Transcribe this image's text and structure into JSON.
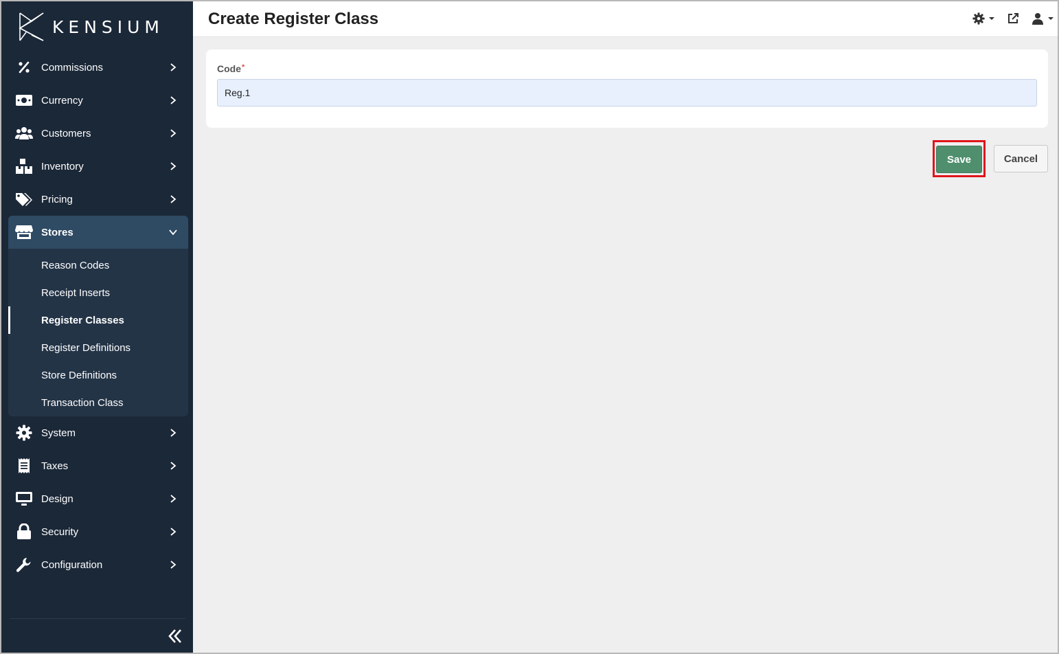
{
  "brand": {
    "name": "KENSIUM"
  },
  "header": {
    "title": "Create Register Class"
  },
  "sidebar": {
    "items": [
      {
        "label": "Commissions",
        "icon": "percent-icon"
      },
      {
        "label": "Currency",
        "icon": "money-bill-icon"
      },
      {
        "label": "Customers",
        "icon": "users-icon"
      },
      {
        "label": "Inventory",
        "icon": "boxes-icon"
      },
      {
        "label": "Pricing",
        "icon": "tags-icon"
      },
      {
        "label": "Stores",
        "icon": "store-icon",
        "expanded": true
      },
      {
        "label": "System",
        "icon": "gear-icon"
      },
      {
        "label": "Taxes",
        "icon": "receipt-icon"
      },
      {
        "label": "Design",
        "icon": "monitor-icon"
      },
      {
        "label": "Security",
        "icon": "lock-icon"
      },
      {
        "label": "Configuration",
        "icon": "wrench-icon"
      }
    ],
    "stores_sub": [
      {
        "label": "Reason Codes"
      },
      {
        "label": "Receipt Inserts"
      },
      {
        "label": "Register Classes",
        "current": true
      },
      {
        "label": "Register Definitions"
      },
      {
        "label": "Store Definitions"
      },
      {
        "label": "Transaction Class"
      }
    ]
  },
  "form": {
    "code_label": "Code",
    "required_mark": "*",
    "code_value": "Reg.1"
  },
  "actions": {
    "save": "Save",
    "cancel": "Cancel"
  },
  "colors": {
    "sidebar": "#1b2838",
    "active": "#2f4a63",
    "save": "#4f8f6e",
    "highlight": "#e0151a"
  }
}
